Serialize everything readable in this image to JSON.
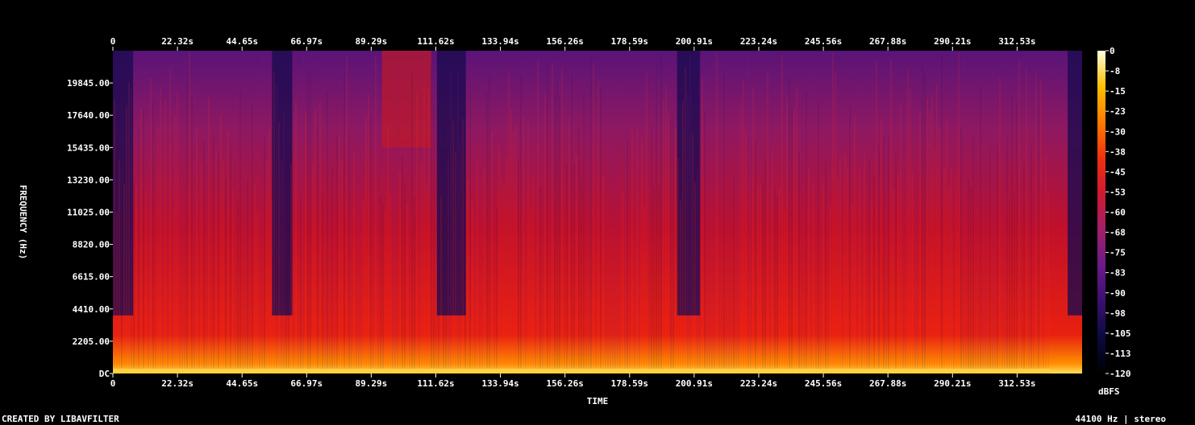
{
  "chart_data": {
    "type": "heatmap",
    "subtype": "spectrogram",
    "xlabel": "TIME",
    "ylabel": "FREQUENCY (Hz)",
    "x_unit": "s",
    "x_ticks": [
      "0",
      "22.32s",
      "44.65s",
      "66.97s",
      "89.29s",
      "111.62s",
      "133.94s",
      "156.26s",
      "178.59s",
      "200.91s",
      "223.24s",
      "245.56s",
      "267.88s",
      "290.21s",
      "312.53s"
    ],
    "x_tick_values": [
      0,
      22.32,
      44.65,
      66.97,
      89.29,
      111.62,
      133.94,
      156.26,
      178.59,
      200.91,
      223.24,
      245.56,
      267.88,
      290.21,
      312.53
    ],
    "xlim": [
      0,
      335
    ],
    "y_ticks": [
      "DC",
      "2205.00",
      "4410.00",
      "6615.00",
      "8820.00",
      "11025.00",
      "13230.00",
      "15435.00",
      "17640.00",
      "19845.00"
    ],
    "y_tick_values": [
      0,
      2205,
      4410,
      6615,
      8820,
      11025,
      13230,
      15435,
      17640,
      19845
    ],
    "ylim": [
      0,
      22050
    ],
    "colorbar": {
      "label": "dBFS",
      "ticks": [
        "0",
        "-8",
        "-15",
        "-23",
        "-30",
        "-38",
        "-45",
        "-53",
        "-60",
        "-68",
        "-75",
        "-83",
        "-90",
        "-98",
        "-105",
        "-113",
        "-120"
      ],
      "range": [
        -120,
        0
      ],
      "colors": [
        "#000000",
        "#0a0a40",
        "#3a0f6e",
        "#6a1a8a",
        "#a0206a",
        "#d01830",
        "#f03010",
        "#ff7a00",
        "#ffc000",
        "#ffffe0"
      ]
    },
    "quiet_segments_s": [
      [
        0,
        7
      ],
      [
        55,
        62
      ],
      [
        112,
        122
      ],
      [
        195,
        203
      ],
      [
        330,
        335
      ]
    ],
    "loud_segments_s": [
      [
        93,
        110
      ]
    ]
  },
  "footer": {
    "credit": "CREATED BY LIBAVFILTER",
    "info": "44100 Hz | stereo"
  }
}
